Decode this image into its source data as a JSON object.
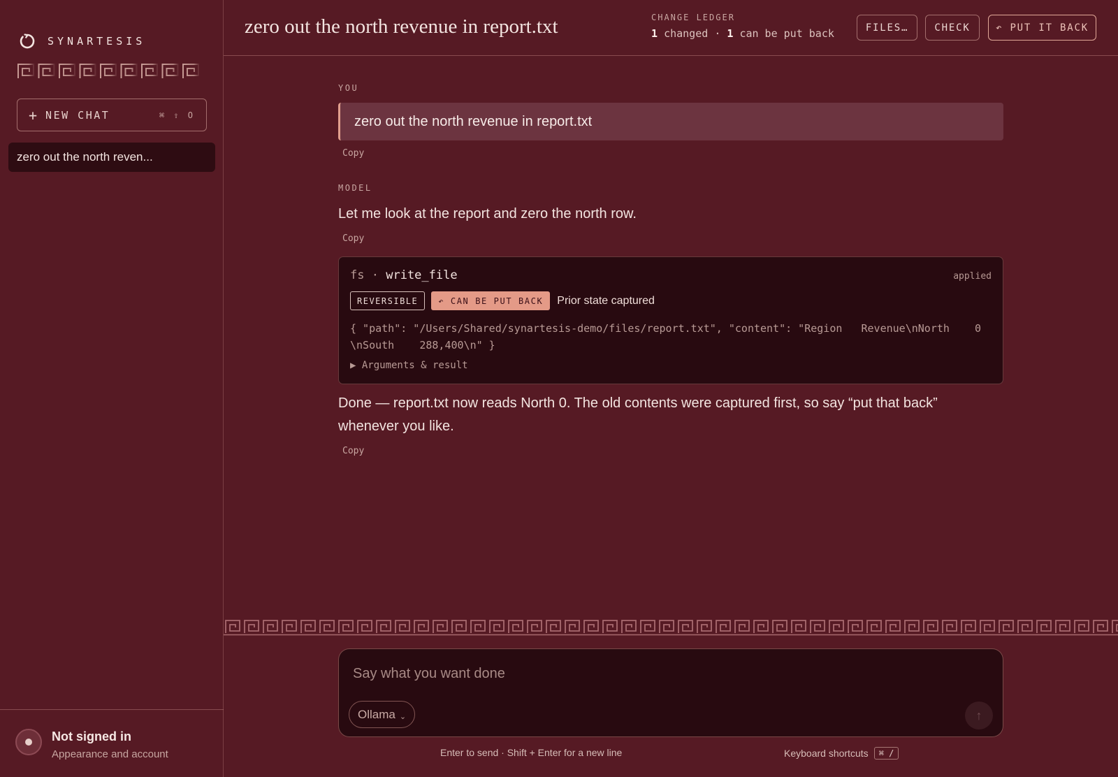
{
  "sidebar": {
    "brand_name": "SYNARTESIS",
    "brand_icon": "power-swirl-icon",
    "new_chat_label": "NEW CHAT",
    "new_chat_shortcut": "⌘ ⇧ O",
    "chats": [
      {
        "label": "zero out the north reven..."
      }
    ],
    "account": {
      "name": "Not signed in",
      "subtitle": "Appearance and account"
    }
  },
  "header": {
    "title": "zero out the north revenue in report.txt",
    "ledger_label": "CHANGE LEDGER",
    "ledger_changed": "1",
    "ledger_changed_text": "changed",
    "ledger_separator": "·",
    "ledger_putback": "1",
    "ledger_putback_text": "can be put back",
    "buttons": {
      "files": "FILES…",
      "check": "CHECK",
      "put_back": "↶ PUT IT BACK"
    }
  },
  "conversation": {
    "user_role": "YOU",
    "user_message": "zero out the north revenue in report.txt",
    "copy_label": "Copy",
    "model_role": "MODEL",
    "model_intro": "Let me look at the report and zero the north row.",
    "tool": {
      "namespace": "fs",
      "separator": "·",
      "name": "write_file",
      "status": "applied",
      "badge_reversible": "REVERSIBLE",
      "badge_put_back": "↶ CAN BE PUT BACK",
      "note": "Prior state captured",
      "args": "{ \"path\": \"/Users/Shared/synartesis-demo/files/report.txt\", \"content\": \"Region   Revenue\\nNorth    0\\nSouth    288,400\\n\" }",
      "toggle_label": "▶ Arguments & result"
    },
    "model_done": "Done — report.txt now reads North 0. The old contents were captured first, so say “put that back” whenever you like."
  },
  "composer": {
    "placeholder": "Say what you want done",
    "value": "",
    "model": "Ollama",
    "send_icon": "arrow-up-icon",
    "hint_send": "Enter to send · Shift + Enter for a new line",
    "hint_shortcuts": "Keyboard shortcuts",
    "shortcut_key": "⌘ /"
  },
  "colors": {
    "background": "#561a24",
    "card": "#280a10",
    "accent": "#e49a87",
    "user_bubble": "#6c3440"
  }
}
